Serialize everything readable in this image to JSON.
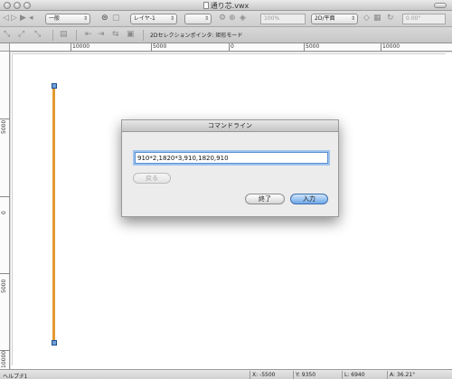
{
  "window": {
    "title": "通り芯.vwx"
  },
  "toolbar": {
    "class_select": "一般",
    "layer_select": "レイヤ-1",
    "zoom": "100%",
    "view_select": "2D/平面",
    "rotation": "0.00°"
  },
  "tool": {
    "mode_label": "2Dセレクションポインタ: 矩形モード"
  },
  "ruler": {
    "top_labels": [
      "10000",
      "5000",
      "0",
      "5000",
      "10000"
    ],
    "left_labels": [
      "5000",
      "0",
      "5000",
      "10000"
    ]
  },
  "dialog": {
    "title": "コマンドライン",
    "input_value": "910*2,1820*3,910,1820,910",
    "back_label": "戻る",
    "cancel_label": "終了",
    "ok_label": "入力"
  },
  "status": {
    "help": "ヘルプ:F1",
    "x": "X:  -5500",
    "y": "Y:  9350",
    "l": "L:  6940",
    "a": "A:  36.21°"
  },
  "colors": {
    "line": "#e49a2e",
    "handle": "#6f9fd8",
    "accent": "#5d8fd0"
  },
  "icons": [
    "close-light-icon",
    "minimize-light-icon",
    "zoom-light-icon",
    "layers-icon",
    "snap-icon"
  ]
}
